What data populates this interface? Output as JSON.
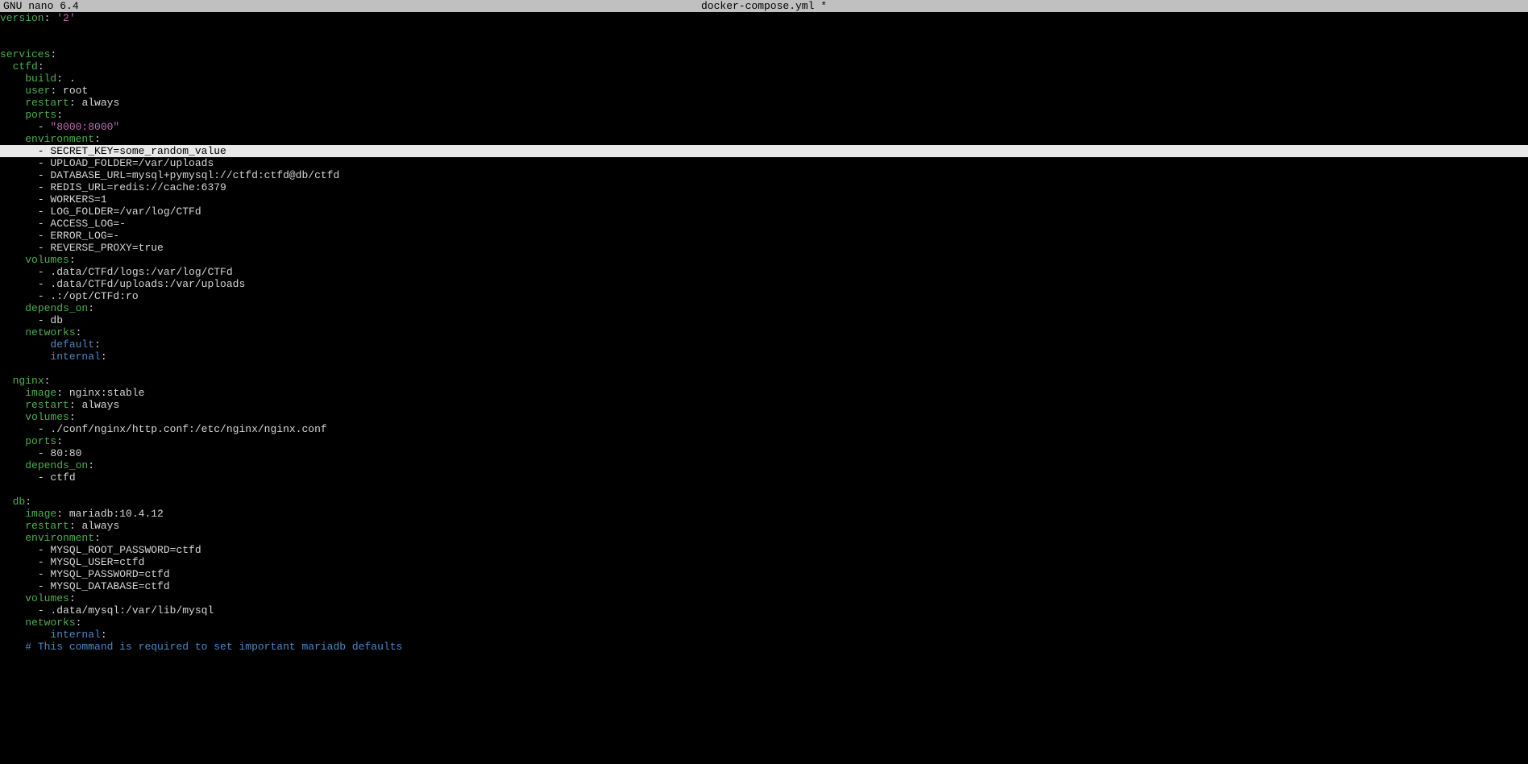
{
  "titlebar": {
    "app": "  GNU nano 6.4",
    "filename": "docker-compose.yml *"
  },
  "file": {
    "version_key": "version",
    "version_val": "'2'",
    "services_key": "services",
    "ctfd": {
      "name": "ctfd",
      "build_key": "build",
      "build_val": ".",
      "user_key": "user",
      "user_val": "root",
      "restart_key": "restart",
      "restart_val": "always",
      "ports_key": "ports",
      "port": "\"8000:8000\"",
      "env_key": "environment",
      "env": [
        "SECRET_KEY=some_random_value",
        "UPLOAD_FOLDER=/var/uploads",
        "DATABASE_URL=mysql+pymysql://ctfd:ctfd@db/ctfd",
        "REDIS_URL=redis://cache:6379",
        "WORKERS=1",
        "LOG_FOLDER=/var/log/CTFd",
        "ACCESS_LOG=-",
        "ERROR_LOG=-",
        "REVERSE_PROXY=true"
      ],
      "volumes_key": "volumes",
      "volumes": [
        ".data/CTFd/logs:/var/log/CTFd",
        ".data/CTFd/uploads:/var/uploads",
        ".:/opt/CTFd:ro"
      ],
      "depends_key": "depends_on",
      "depends": [
        "db"
      ],
      "networks_key": "networks",
      "networks": [
        "default",
        "internal"
      ]
    },
    "nginx": {
      "name": "nginx",
      "image_key": "image",
      "image_val": "nginx:stable",
      "restart_key": "restart",
      "restart_val": "always",
      "volumes_key": "volumes",
      "volumes": [
        "./conf/nginx/http.conf:/etc/nginx/nginx.conf"
      ],
      "ports_key": "ports",
      "ports": [
        "80:80"
      ],
      "depends_key": "depends_on",
      "depends": [
        "ctfd"
      ]
    },
    "db": {
      "name": "db",
      "image_key": "image",
      "image_val": "mariadb:10.4.12",
      "restart_key": "restart",
      "restart_val": "always",
      "env_key": "environment",
      "env": [
        "MYSQL_ROOT_PASSWORD=ctfd",
        "MYSQL_USER=ctfd",
        "MYSQL_PASSWORD=ctfd",
        "MYSQL_DATABASE=ctfd"
      ],
      "volumes_key": "volumes",
      "volumes": [
        ".data/mysql:/var/lib/mysql"
      ],
      "networks_key": "networks",
      "networks": [
        "internal"
      ],
      "comment": "# This command is required to set important mariadb defaults"
    }
  }
}
